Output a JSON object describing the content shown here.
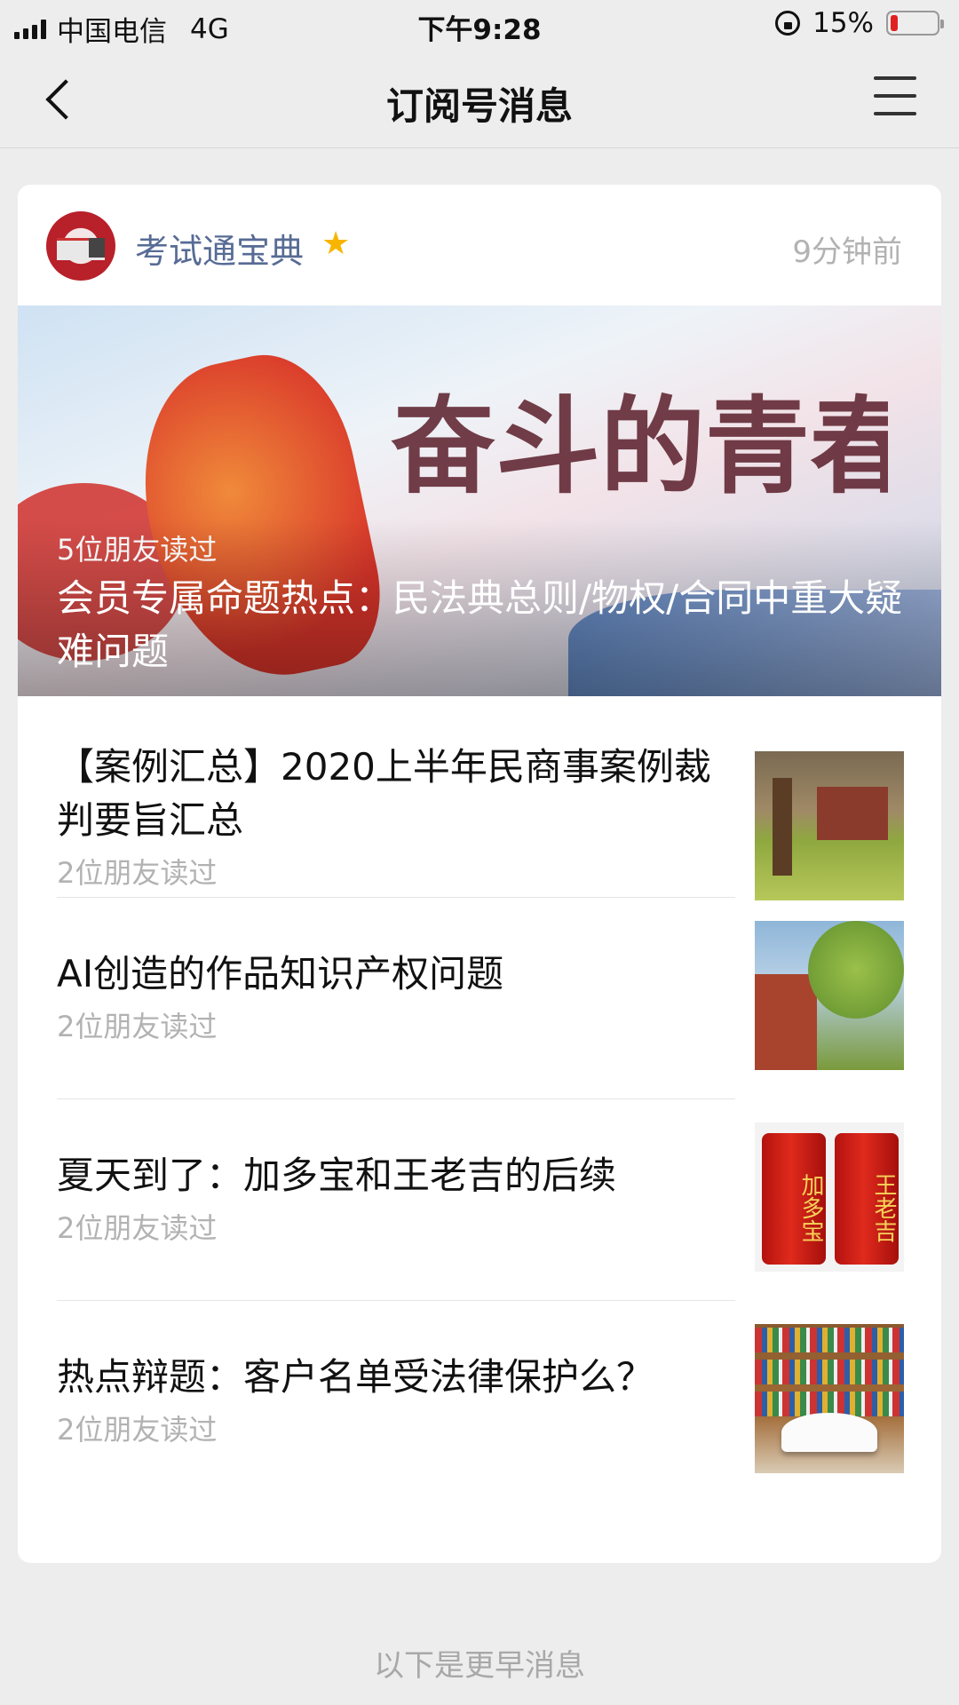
{
  "status_bar": {
    "carrier": "中国电信",
    "network": "4G",
    "time": "下午9:28",
    "battery_percent": "15%",
    "battery_level": 0.15,
    "battery_color": "#e02020"
  },
  "nav": {
    "title": "订阅号消息",
    "back_icon": "back-chevron-icon",
    "menu_icon": "menu-icon"
  },
  "card": {
    "account_name": "考试通宝典",
    "star_icon": "star-icon",
    "star_color": "#f7b500",
    "time_ago": "9分钟前",
    "hero": {
      "reads": "5位朋友读过",
      "title": "会员专属命题热点：民法典总则/物权/合同中重大疑难问题",
      "image_text": "奋斗的青春最美丽"
    },
    "articles": [
      {
        "title": "【案例汇总】2020上半年民商事案例裁判要旨汇总",
        "reads": "2位朋友读过",
        "thumb": "campus-photo"
      },
      {
        "title": "AI创造的作品知识产权问题",
        "reads": "2位朋友读过",
        "thumb": "building-photo"
      },
      {
        "title": "夏天到了：加多宝和王老吉的后续",
        "reads": "2位朋友读过",
        "thumb": "cans-photo",
        "thumb_labels": [
          "加多宝",
          "王老吉"
        ]
      },
      {
        "title": "热点辩题：客户名单受法律保护么？",
        "reads": "2位朋友读过",
        "thumb": "books-photo"
      }
    ]
  },
  "footer": {
    "earlier_label": "以下是更早消息"
  },
  "colors": {
    "link_blue": "#576b95",
    "background": "#ededed",
    "muted_text": "#b2b2b2"
  }
}
